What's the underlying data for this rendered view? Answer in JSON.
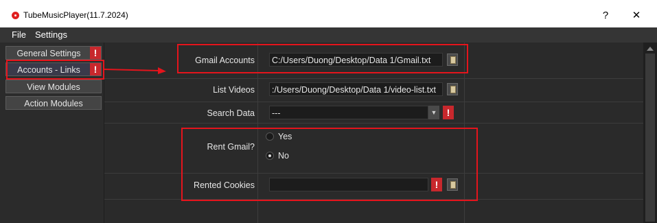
{
  "window": {
    "title": "TubeMusicPlayer(11.7.2024)",
    "help": "?",
    "close": "✕"
  },
  "menu": [
    "File",
    "Settings"
  ],
  "nav": [
    {
      "label": "General Settings",
      "alert": "!"
    },
    {
      "label": "Accounts - Links",
      "alert": "!"
    },
    {
      "label": "View Modules"
    },
    {
      "label": "Action Modules"
    }
  ],
  "fields": {
    "gmail_accounts": {
      "label": "Gmail Accounts",
      "value": "C:/Users/Duong/Desktop/Data 1/Gmail.txt"
    },
    "list_videos": {
      "label": "List Videos",
      "value": ":/Users/Duong/Desktop/Data 1/video-list.txt"
    },
    "search_data": {
      "label": "Search Data",
      "value": "---",
      "alert": "!"
    },
    "rent_gmail": {
      "label": "Rent Gmail?",
      "options": [
        "Yes",
        "No"
      ],
      "selected": "No"
    },
    "rented_cookies": {
      "label": "Rented Cookies",
      "value": "",
      "alert": "!"
    }
  },
  "colors": {
    "annotation": "#e5141c",
    "alert": "#c8282d"
  }
}
